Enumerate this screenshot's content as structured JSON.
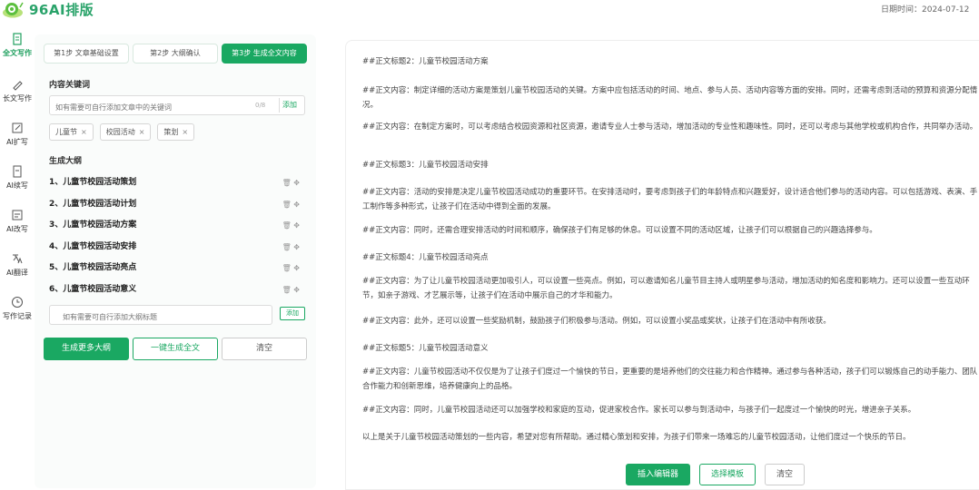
{
  "header": {
    "brand": "96AI排版",
    "date_label": "日期时间：2024-07-12"
  },
  "nav": {
    "items": [
      {
        "label": "全文写作",
        "icon": "document-icon",
        "active": true
      },
      {
        "label": "长文写作",
        "icon": "pen-icon",
        "active": false
      },
      {
        "label": "AI扩写",
        "icon": "edit-icon",
        "active": false
      },
      {
        "label": "AI续写",
        "icon": "continue-icon",
        "active": false
      },
      {
        "label": "AI改写",
        "icon": "rewrite-icon",
        "active": false
      },
      {
        "label": "AI翻译",
        "icon": "translate-icon",
        "active": false
      },
      {
        "label": "写作记录",
        "icon": "clock-icon",
        "active": false
      }
    ]
  },
  "steps": [
    {
      "label": "第1步 文章基础设置",
      "active": false
    },
    {
      "label": "第2步 大纲确认",
      "active": false
    },
    {
      "label": "第3步 生成全文内容",
      "active": true
    }
  ],
  "keywords": {
    "label": "内容关键词",
    "placeholder": "如有需要可自行添加文章中的关键词",
    "count": "0/8",
    "add_label": "添加",
    "tags": [
      "儿童节",
      "校园活动",
      "策划"
    ],
    "close_glyph": "×"
  },
  "outline": {
    "label": "生成大纲",
    "items": [
      "1、儿童节校园活动策划",
      "2、儿童节校园活动计划",
      "3、儿童节校园活动方案",
      "4、儿童节校园活动安排",
      "5、儿童节校园活动亮点",
      "6、儿童节校园活动意义"
    ],
    "delete_glyph": "🗑",
    "move_glyph": "✥",
    "new_placeholder": "如有需要可自行添加大纲标题",
    "add_label": "添加"
  },
  "actions": {
    "generate_more": "生成更多大纲",
    "one_click": "一键生成全文",
    "clear": "清空"
  },
  "article": {
    "paragraphs": [
      "##正文标题2：儿童节校园活动方案",
      "##正文内容：制定详细的活动方案是策划儿童节校园活动的关键。方案中应包括活动的时间、地点、参与人员、活动内容等方面的安排。同时，还需考虑到活动的预算和资源分配情况。",
      "##正文内容：在制定方案时，可以考虑结合校园资源和社区资源，邀请专业人士参与活动，增加活动的专业性和趣味性。同时，还可以考虑与其他学校或机构合作，共同举办活动。",
      "##正文标题3：儿童节校园活动安排",
      "##正文内容：活动的安排是决定儿童节校园活动成功的重要环节。在安排活动时，要考虑到孩子们的年龄特点和兴趣爱好，设计适合他们参与的活动内容。可以包括游戏、表演、手工制作等多种形式，让孩子们在活动中得到全面的发展。",
      "##正文内容：同时，还需合理安排活动的时间和顺序，确保孩子们有足够的休息。可以设置不同的活动区域，让孩子们可以根据自己的兴趣选择参与。",
      "##正文标题4：儿童节校园活动亮点",
      "##正文内容：为了让儿童节校园活动更加吸引人，可以设置一些亮点。例如，可以邀请知名儿童节目主持人或明星参与活动，增加活动的知名度和影响力。还可以设置一些互动环节，如亲子游戏、才艺展示等，让孩子们在活动中展示自己的才华和能力。",
      "##正文内容：此外，还可以设置一些奖励机制，鼓励孩子们积极参与活动。例如，可以设置小奖品或奖状，让孩子们在活动中有所收获。",
      "##正文标题5：儿童节校园活动意义",
      "##正文内容：儿童节校园活动不仅仅是为了让孩子们度过一个愉快的节日，更重要的是培养他们的交往能力和合作精神。通过参与各种活动，孩子们可以锻炼自己的动手能力、团队合作能力和创新思维，培养健康向上的品格。",
      "##正文内容：同时，儿童节校园活动还可以加强学校和家庭的互动，促进家校合作。家长可以参与到活动中，与孩子们一起度过一个愉快的时光，增进亲子关系。",
      "以上是关于儿童节校园活动策划的一些内容，希望对您有所帮助。通过精心策划和安排，为孩子们带来一场难忘的儿童节校园活动，让他们度过一个快乐的节日。"
    ],
    "insert_label": "插入编辑器",
    "template_label": "选择模板",
    "clear_label": "清空"
  }
}
